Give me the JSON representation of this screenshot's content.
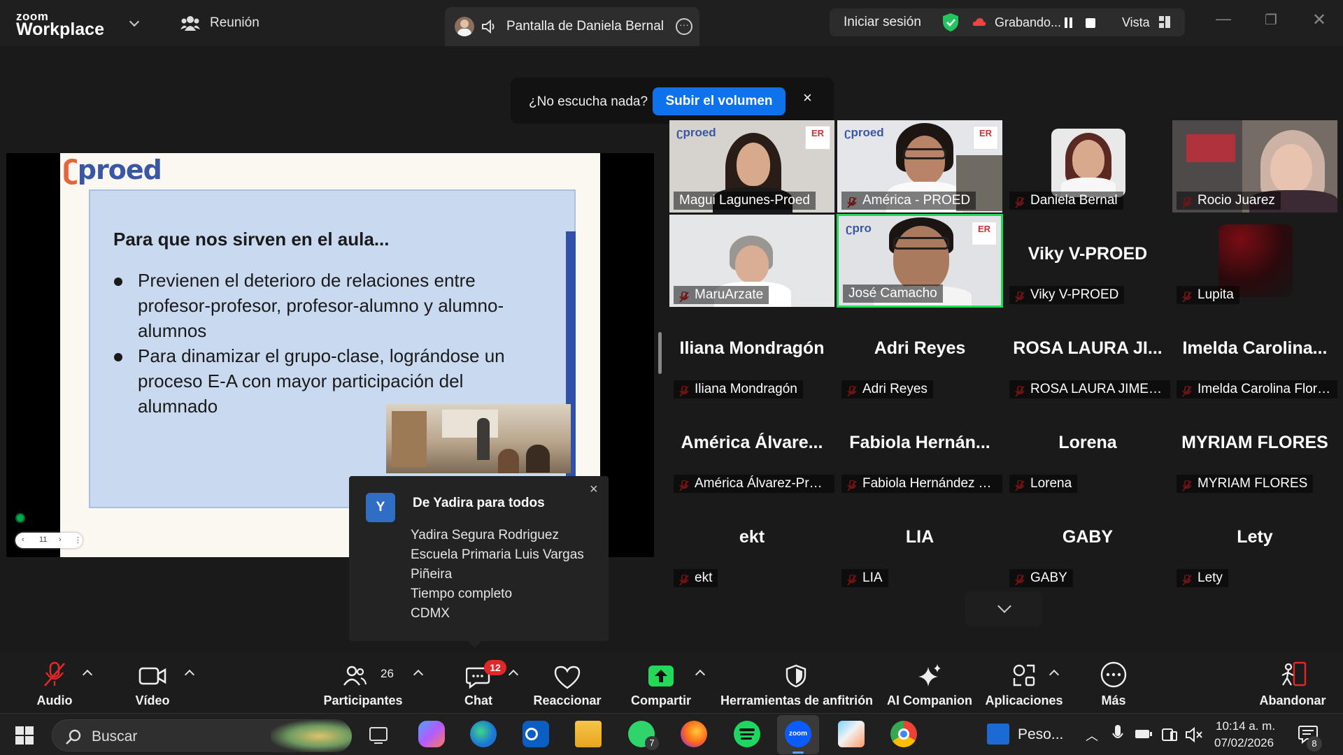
{
  "titlebar": {
    "brand_top": "zoom",
    "brand_bottom": "Workplace",
    "meeting_label": "Reunión",
    "share_label": "Pantalla de Daniela Bernal",
    "signin_label": "Iniciar sesión",
    "recording_label": "Grabando...",
    "view_label": "Vista"
  },
  "audio_notice": {
    "question": "¿No escucha nada?",
    "button": "Subir el volumen",
    "close": "×"
  },
  "slide": {
    "logo": "proed",
    "title": "Para que nos sirven en el aula...",
    "bullets": [
      "Previenen el deterioro de relaciones entre profesor-profesor, profesor-alumno y alumno-alumnos",
      "Para dinamizar el grupo-clase, lográndose un proceso E-A con mayor participación del alumnado"
    ],
    "page_number": "11"
  },
  "chat_popup": {
    "avatar_letter": "Y",
    "from": "De Yadira para todos",
    "lines": [
      "Yadira Segura Rodriguez",
      "Escuela Primaria Luis Vargas",
      "Piñeira",
      "Tiempo completo",
      "CDMX"
    ],
    "close": "×"
  },
  "gallery": {
    "tiles": [
      {
        "name": "Magui Lagunes-Proed",
        "muted": false,
        "big": ""
      },
      {
        "name": "América - PROED",
        "muted": true,
        "big": ""
      },
      {
        "name": "Daniela Bernal",
        "muted": true,
        "big": ""
      },
      {
        "name": "Rocio Juarez",
        "muted": true,
        "big": ""
      },
      {
        "name": "MaruArzate",
        "muted": true,
        "big": ""
      },
      {
        "name": "José Camacho",
        "muted": false,
        "big": ""
      },
      {
        "name": "Viky V-PROED",
        "muted": true,
        "big": "Viky V-PROED"
      },
      {
        "name": "Lupita",
        "muted": true,
        "big": ""
      },
      {
        "name": "Iliana Mondragón",
        "muted": true,
        "big": "Iliana Mondragón"
      },
      {
        "name": "Adri Reyes",
        "muted": true,
        "big": "Adri Reyes"
      },
      {
        "name": "ROSA LAURA JIMENEZ...",
        "muted": true,
        "big": "ROSA LAURA JI..."
      },
      {
        "name": "Imelda Carolina Flores...",
        "muted": true,
        "big": "Imelda Carolina..."
      },
      {
        "name": "América Álvarez-Proed",
        "muted": true,
        "big": "América Álvare..."
      },
      {
        "name": "Fabiola Hernández Trejo",
        "muted": true,
        "big": "Fabiola Hernán..."
      },
      {
        "name": "Lorena",
        "muted": true,
        "big": "Lorena"
      },
      {
        "name": "MYRIAM FLORES",
        "muted": true,
        "big": "MYRIAM FLORES"
      },
      {
        "name": "ekt",
        "muted": true,
        "big": "ekt"
      },
      {
        "name": "LIA",
        "muted": true,
        "big": "LIA"
      },
      {
        "name": "GABY",
        "muted": true,
        "big": "GABY"
      },
      {
        "name": "Lety",
        "muted": true,
        "big": "Lety"
      }
    ]
  },
  "toolbar": {
    "audio": "Audio",
    "video": "Vídeo",
    "participants": "Participantes",
    "participants_count": "26",
    "chat": "Chat",
    "chat_badge": "12",
    "react": "Reaccionar",
    "share": "Compartir",
    "host_tools": "Herramientas de anfitrión",
    "ai": "AI Companion",
    "apps": "Aplicaciones",
    "more": "Más",
    "leave": "Abandonar"
  },
  "taskbar": {
    "search_label": "Buscar",
    "whatsapp_badge": "7",
    "weather_text": "Peso...",
    "time": "10:14 a. m.",
    "date": "07/02/2026",
    "notif_count": "8"
  },
  "colors": {
    "accent_blue": "#0e72ed",
    "active_speaker": "#23d959",
    "mute_red": "#e02828",
    "share_green": "#23d959"
  }
}
